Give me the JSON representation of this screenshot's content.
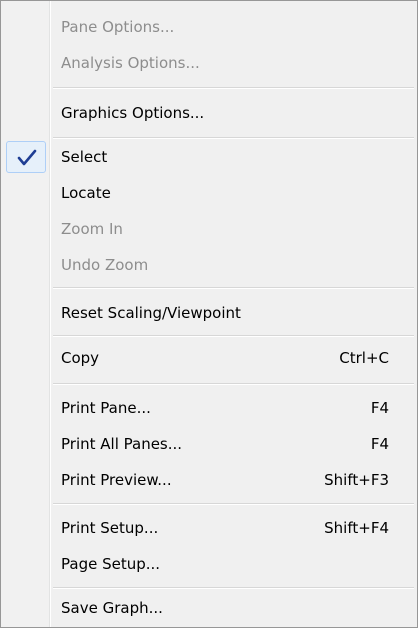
{
  "menu": {
    "items": [
      {
        "label": "Pane Options...",
        "shortcut": "",
        "disabled": true,
        "checked": false
      },
      {
        "label": "Analysis Options...",
        "shortcut": "",
        "disabled": true,
        "checked": false
      },
      {
        "label": "Graphics Options...",
        "shortcut": "",
        "disabled": false,
        "checked": false
      },
      {
        "label": "Select",
        "shortcut": "",
        "disabled": false,
        "checked": true
      },
      {
        "label": "Locate",
        "shortcut": "",
        "disabled": false,
        "checked": false
      },
      {
        "label": "Zoom In",
        "shortcut": "",
        "disabled": true,
        "checked": false
      },
      {
        "label": "Undo Zoom",
        "shortcut": "",
        "disabled": true,
        "checked": false
      },
      {
        "label": "Reset Scaling/Viewpoint",
        "shortcut": "",
        "disabled": false,
        "checked": false
      },
      {
        "label": "Copy",
        "shortcut": "Ctrl+C",
        "disabled": false,
        "checked": false
      },
      {
        "label": "Print Pane...",
        "shortcut": "F4",
        "disabled": false,
        "checked": false
      },
      {
        "label": "Print All Panes...",
        "shortcut": "F4",
        "disabled": false,
        "checked": false
      },
      {
        "label": "Print Preview...",
        "shortcut": "Shift+F3",
        "disabled": false,
        "checked": false
      },
      {
        "label": "Print Setup...",
        "shortcut": "Shift+F4",
        "disabled": false,
        "checked": false
      },
      {
        "label": "Page Setup...",
        "shortcut": "",
        "disabled": false,
        "checked": false
      },
      {
        "label": "Save Graph...",
        "shortcut": "",
        "disabled": false,
        "checked": false
      }
    ],
    "check_icon": "checkmark-icon",
    "colors": {
      "background": "#f0f0f0",
      "disabled_text": "#8d8d8d",
      "check_highlight": "#e6f0fa",
      "check_border": "#aecff7",
      "check_mark": "#1f3e94"
    }
  }
}
